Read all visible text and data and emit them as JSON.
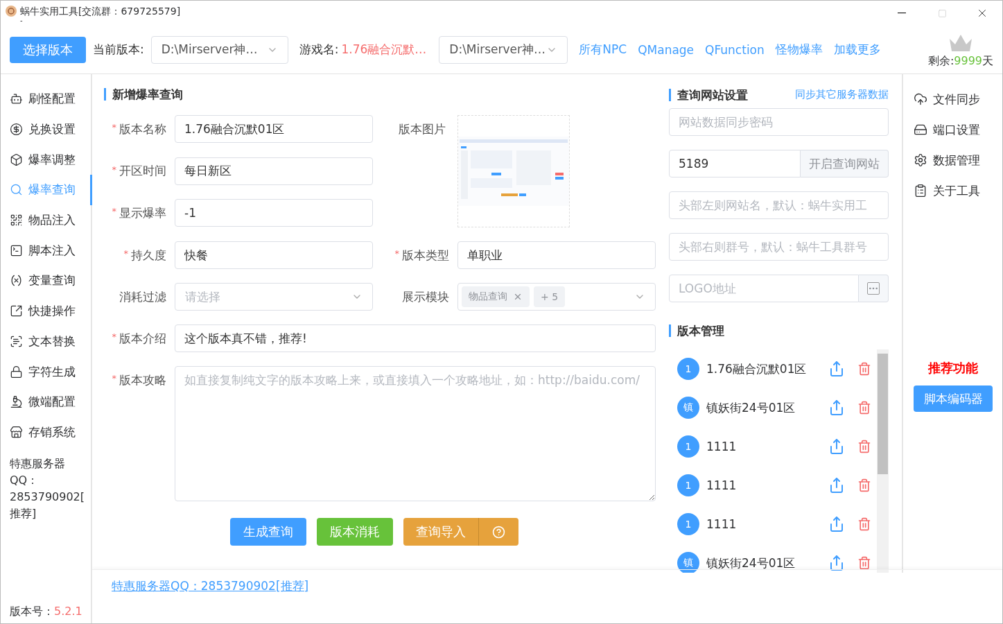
{
  "window": {
    "title": "蜗牛实用工具[交流群：679725579]",
    "subtitle": "-"
  },
  "toolbar": {
    "select_button": "选择版本",
    "current_version_label": "当前版本:",
    "current_version_value": "D:\\Mirserver神…",
    "game_name_label": "游戏名:",
    "game_name_value": "1.76融合沉默…",
    "second_select_value": "D:\\Mirserver神…",
    "links": [
      "所有NPC",
      "QManage",
      "QFunction",
      "怪物爆率",
      "加载更多"
    ],
    "remaining": {
      "label": "剩余:",
      "value": "9999",
      "unit": "天"
    }
  },
  "sidebar": {
    "items": [
      {
        "label": "刷怪配置",
        "selected": false
      },
      {
        "label": "兑换设置",
        "selected": false
      },
      {
        "label": "爆率调整",
        "selected": false
      },
      {
        "label": "爆率查询",
        "selected": true
      },
      {
        "label": "物品注入",
        "selected": false
      },
      {
        "label": "脚本注入",
        "selected": false
      },
      {
        "label": "变量查询",
        "selected": false
      },
      {
        "label": "快捷操作",
        "selected": false
      },
      {
        "label": "文本替换",
        "selected": false
      },
      {
        "label": "字符生成",
        "selected": false
      },
      {
        "label": "微端配置",
        "selected": false
      },
      {
        "label": "存销系统",
        "selected": false
      }
    ],
    "promo": "特惠服务器QQ：2853790902[推荐]",
    "version_label": "版本号：",
    "version_value": "5.2.1"
  },
  "form": {
    "title": "新增爆率查询",
    "required_marker": "*",
    "top_fields": [
      {
        "kind": "text",
        "label": "版本名称",
        "required": true,
        "value": "1.76融合沉默01区"
      },
      {
        "kind": "text",
        "label": "开区时间",
        "required": true,
        "value": "每日新区"
      },
      {
        "kind": "text",
        "label": "显示爆率",
        "required": true,
        "value": "-1"
      }
    ],
    "image": {
      "label": "版本图片",
      "kind": "picture"
    },
    "pair_rows": [
      [
        {
          "kind": "text",
          "label": "持久度",
          "required": true,
          "value": "快餐"
        },
        {
          "kind": "text",
          "label": "版本类型",
          "required": true,
          "value": "单职业"
        }
      ],
      [
        {
          "kind": "select",
          "label": "消耗过滤",
          "required": false,
          "placeholder": "请选择"
        },
        {
          "kind": "tags",
          "label": "展示模块",
          "required": false,
          "tags": [
            "物品查询"
          ],
          "more": "+ 5"
        }
      ]
    ],
    "wide_fields": [
      {
        "kind": "text",
        "label": "版本介绍",
        "required": true,
        "value": "这个版本真不错，推荐!"
      },
      {
        "kind": "textarea",
        "label": "版本攻略",
        "required": true,
        "placeholder": "如直接复制纯文字的版本攻略上来，或直接填入一个攻略地址，如：http://baidu.com/"
      }
    ],
    "buttons": [
      {
        "label": "生成查询",
        "kind": "primary",
        "help": false
      },
      {
        "label": "版本消耗",
        "kind": "success",
        "help": false
      },
      {
        "label": "查询导入",
        "kind": "warning",
        "help": true
      }
    ]
  },
  "footer": {
    "link": "特惠服务器QQ：2853790902[推荐]"
  },
  "site_settings": {
    "title": "查询网站设置",
    "link": "同步其它服务器数据",
    "password_placeholder": "网站数据同步密码",
    "port": {
      "value": "5189",
      "button": "开启查询网站"
    },
    "left_name_placeholder": "头部左则网站名，默认：蜗牛实用工",
    "right_group_placeholder": "头部右则群号，默认：蜗牛工具群号",
    "logo_placeholder": "LOGO地址"
  },
  "versions": {
    "title": "版本管理",
    "items": [
      {
        "badge": "1",
        "name": "1.76融合沉默01区"
      },
      {
        "badge": "镇",
        "name": "镇妖街24号01区"
      },
      {
        "badge": "1",
        "name": "1111"
      },
      {
        "badge": "1",
        "name": "1111"
      },
      {
        "badge": "1",
        "name": "1111"
      },
      {
        "badge": "镇",
        "name": "镇妖街24号01区"
      }
    ]
  },
  "right_menu": {
    "items": [
      "文件同步",
      "端口设置",
      "数据管理",
      "关于工具"
    ],
    "recommend_title": "推荐功能",
    "recommend_button": "脚本编码器"
  }
}
